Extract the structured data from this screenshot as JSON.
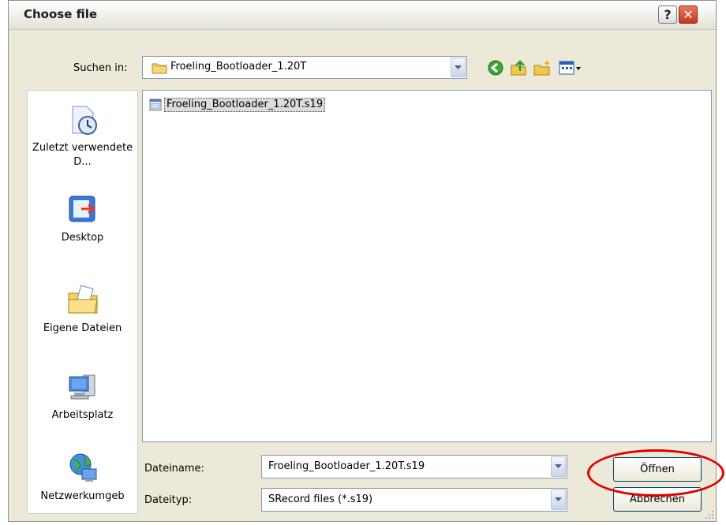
{
  "window": {
    "title": "Choose file",
    "help_label": "?",
    "close_label": "✕"
  },
  "lookin": {
    "label": "Suchen in:",
    "folder": "Froeling_Bootloader_1.20T"
  },
  "toolbar": {
    "icons": [
      "back-icon",
      "up-folder-icon",
      "new-folder-icon",
      "view-menu-icon"
    ]
  },
  "places": [
    {
      "label": "Zuletzt verwendete D...",
      "icon": "recent-documents-icon"
    },
    {
      "label": "Desktop",
      "icon": "desktop-icon"
    },
    {
      "label": "Eigene Dateien",
      "icon": "my-documents-icon"
    },
    {
      "label": "Arbeitsplatz",
      "icon": "my-computer-icon"
    },
    {
      "label": "Netzwerkumgeb",
      "icon": "network-icon"
    }
  ],
  "files": [
    {
      "name": "Froeling_Bootloader_1.20T.s19",
      "selected": true
    }
  ],
  "filename": {
    "label": "Dateiname:",
    "value": "Froeling_Bootloader_1.20T.s19"
  },
  "filetype": {
    "label": "Dateityp:",
    "value": "SRecord files (*.s19)"
  },
  "buttons": {
    "open": "Öffnen",
    "cancel": "Abbrechen"
  },
  "colors": {
    "highlight_ring": "#e00000",
    "close_button": "#c6361b",
    "dialog_bg": "#ece9d8"
  }
}
